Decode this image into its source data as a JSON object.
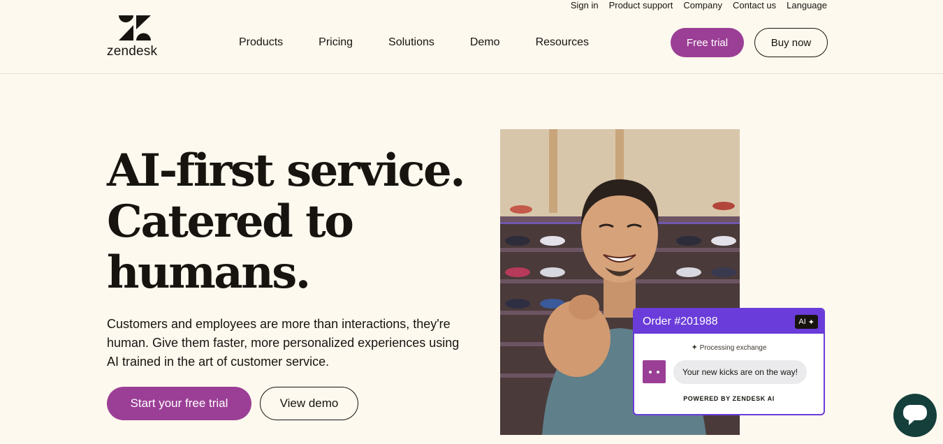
{
  "header": {
    "utility_links": [
      "Sign in",
      "Product support",
      "Company",
      "Contact us",
      "Language"
    ],
    "logo_text": "zendesk",
    "nav": [
      "Products",
      "Pricing",
      "Solutions",
      "Demo",
      "Resources"
    ],
    "free_trial_label": "Free trial",
    "buy_now_label": "Buy now"
  },
  "hero": {
    "heading_lines": [
      "AI-first service.",
      "Catered to",
      "humans."
    ],
    "subheading": "Customers and employees are more than interactions, they're human. Give them faster, more personalized experiences using AI trained in the art of customer service.",
    "primary_cta": "Start your free trial",
    "secondary_cta": "View demo"
  },
  "order_card": {
    "title": "Order #201988",
    "badge": "AI",
    "status": "Processing exchange",
    "message": "Your new kicks are on the way!",
    "footer": "POWERED BY ZENDESK AI"
  },
  "colors": {
    "background": "#fdf9ef",
    "brand_purple": "#9b3f96",
    "card_accent": "#6a3cd9",
    "launcher": "#153f3b"
  },
  "icons": {
    "logo": "zendesk-logo-icon",
    "chat_launcher": "chat-bubble-icon",
    "sparkle": "sparkle-icon"
  }
}
